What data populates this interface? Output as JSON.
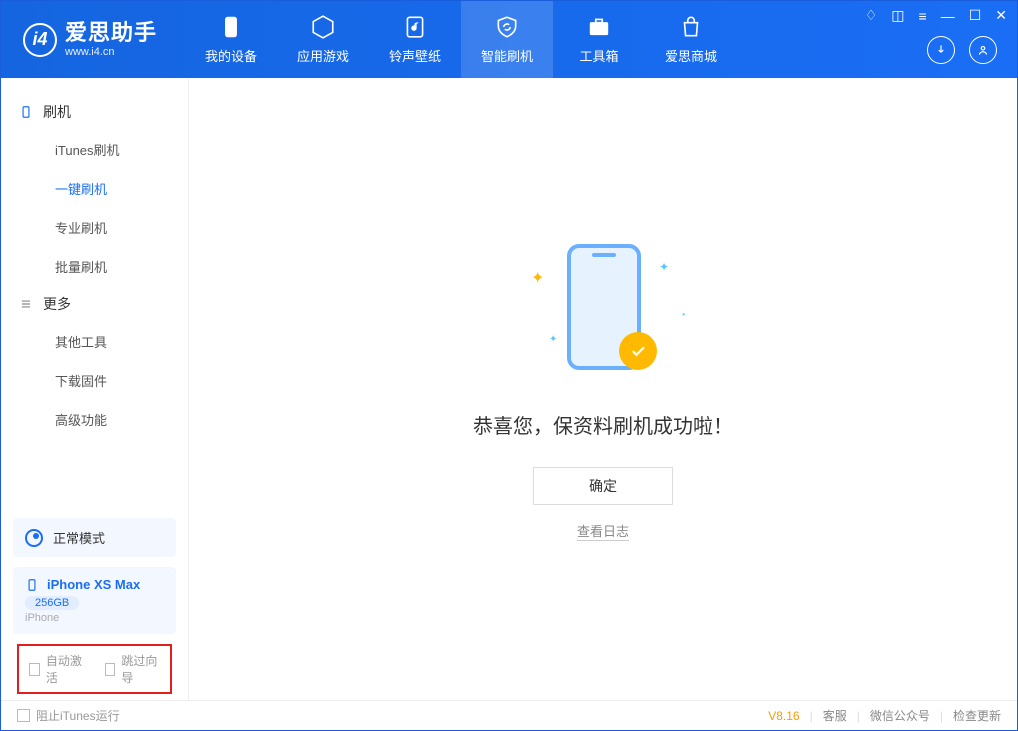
{
  "app": {
    "title": "爱思助手",
    "subtitle": "www.i4.cn",
    "logo_letter": "i4"
  },
  "nav": {
    "tabs": [
      {
        "label": "我的设备"
      },
      {
        "label": "应用游戏"
      },
      {
        "label": "铃声壁纸"
      },
      {
        "label": "智能刷机"
      },
      {
        "label": "工具箱"
      },
      {
        "label": "爱思商城"
      }
    ]
  },
  "sidebar": {
    "group1": {
      "title": "刷机",
      "items": [
        "iTunes刷机",
        "一键刷机",
        "专业刷机",
        "批量刷机"
      ]
    },
    "group2": {
      "title": "更多",
      "items": [
        "其他工具",
        "下载固件",
        "高级功能"
      ]
    },
    "mode_label": "正常模式",
    "device": {
      "name": "iPhone XS Max",
      "storage": "256GB",
      "type": "iPhone"
    },
    "opt_auto_activate": "自动激活",
    "opt_skip_guide": "跳过向导"
  },
  "main": {
    "success_msg": "恭喜您，保资料刷机成功啦！",
    "ok_button": "确定",
    "log_link": "查看日志"
  },
  "statusbar": {
    "block_itunes": "阻止iTunes运行",
    "version": "V8.16",
    "links": [
      "客服",
      "微信公众号",
      "检查更新"
    ]
  }
}
